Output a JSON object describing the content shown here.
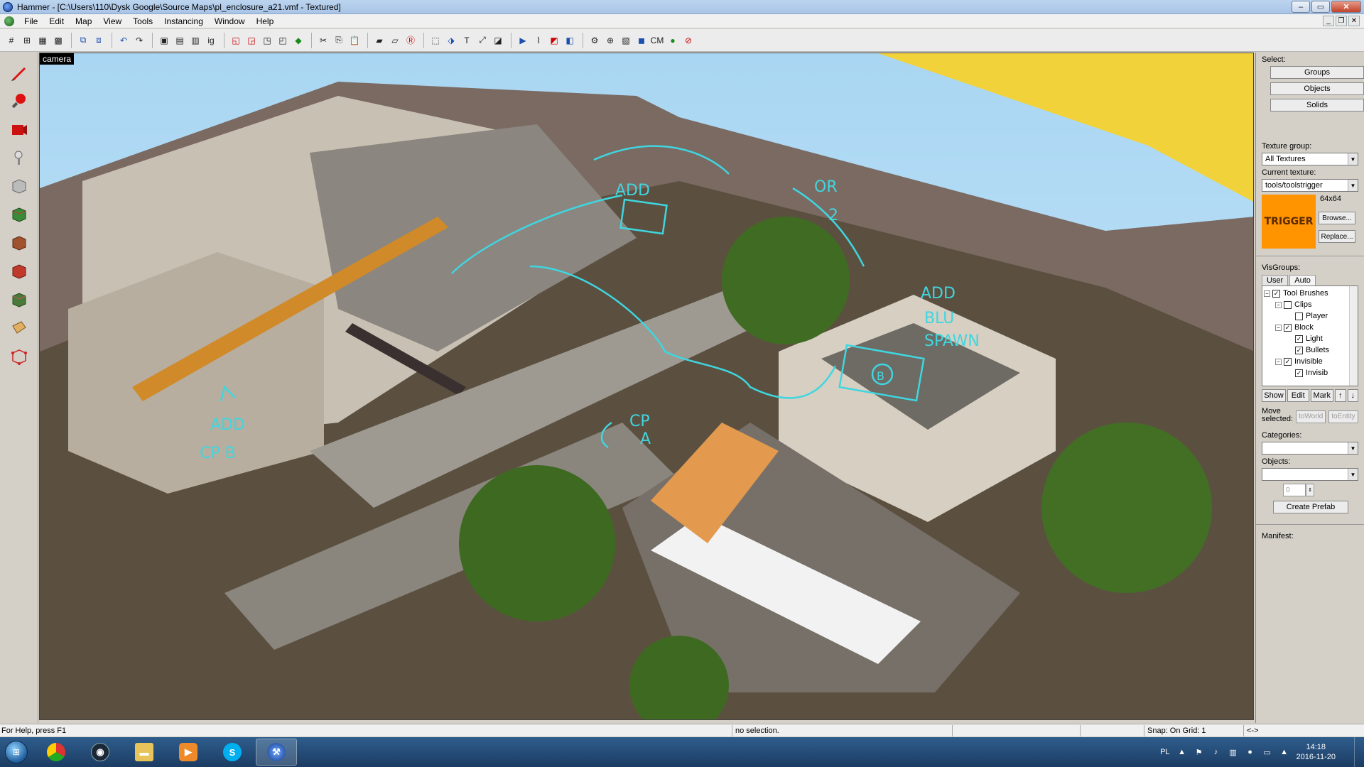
{
  "window": {
    "title": "Hammer - [C:\\Users\\110\\Dysk Google\\Source Maps\\pl_enclosure_a21.vmf - Textured]"
  },
  "menu": {
    "items": [
      "File",
      "Edit",
      "Map",
      "View",
      "Tools",
      "Instancing",
      "Window",
      "Help"
    ]
  },
  "viewport": {
    "label": "camera",
    "annotations": [
      {
        "text": "ADD"
      },
      {
        "text": "OR"
      },
      {
        "text": "2"
      },
      {
        "text": "ADD"
      },
      {
        "text": "BLU"
      },
      {
        "text": "SPAWN"
      },
      {
        "text": "B"
      },
      {
        "text": "ADD"
      },
      {
        "text": "CP B"
      },
      {
        "text": "CP"
      },
      {
        "text": "A"
      }
    ]
  },
  "select_panel": {
    "label": "Select:",
    "groups": "Groups",
    "objects": "Objects",
    "solids": "Solids"
  },
  "texture": {
    "group_label": "Texture group:",
    "group_value": "All Textures",
    "current_label": "Current texture:",
    "current_value": "tools/toolstrigger",
    "size": "64x64",
    "preview_text": "TRIGGER",
    "browse": "Browse...",
    "replace": "Replace..."
  },
  "visgroups": {
    "label": "VisGroups:",
    "tabs": [
      "User",
      "Auto"
    ],
    "tree": [
      {
        "label": "Tool Brushes",
        "checked": true
      },
      {
        "label": "Clips",
        "checked": false
      },
      {
        "label": "Player",
        "checked": false
      },
      {
        "label": "Block",
        "checked": true
      },
      {
        "label": "Light",
        "checked": true
      },
      {
        "label": "Bullets",
        "checked": true
      },
      {
        "label": "Invisible",
        "checked": true
      },
      {
        "label": "Invisib",
        "checked": true
      }
    ],
    "show": "Show",
    "edit": "Edit",
    "mark": "Mark",
    "up": "↑",
    "down": "↓"
  },
  "move": {
    "label": "Move selected:",
    "to_world": "toWorld",
    "to_entity": "toEntity"
  },
  "prefab": {
    "categories_label": "Categories:",
    "objects_label": "Objects:",
    "count": "0",
    "create": "Create Prefab"
  },
  "manifest": {
    "label": "Manifest:"
  },
  "status": {
    "help": "For Help, press F1",
    "selection": "no selection.",
    "snap": "Snap: On Grid: 1",
    "arrows": "<->"
  },
  "taskbar": {
    "language": "PL",
    "time": "14:18",
    "date": "2016-11-20"
  },
  "colors": {
    "trigger_texture": "#ff9300",
    "annotation_ink": "#3fd6e0",
    "sky": "#a9d6f2"
  }
}
